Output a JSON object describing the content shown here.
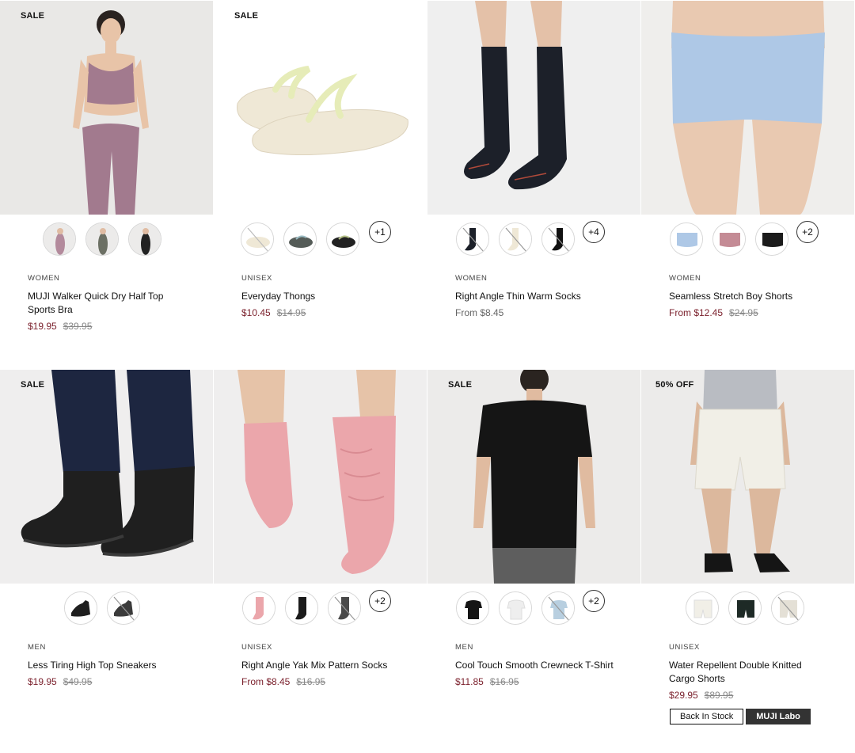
{
  "products": [
    {
      "badge": "SALE",
      "category": "WOMEN",
      "name": "MUJI Walker Quick Dry Half Top Sports Bra",
      "price": "$19.95",
      "original_price": "$39.95",
      "more_colors": ""
    },
    {
      "badge": "SALE",
      "category": "UNISEX",
      "name": "Everyday Thongs",
      "price": "$10.45",
      "original_price": "$14.95",
      "more_colors": "+1"
    },
    {
      "badge": "",
      "category": "WOMEN",
      "name": "Right Angle Thin Warm Socks",
      "price": "From $8.45",
      "original_price": "",
      "more_colors": "+4"
    },
    {
      "badge": "",
      "category": "WOMEN",
      "name": "Seamless Stretch Boy Shorts",
      "price": "From $12.45",
      "original_price": "$24.95",
      "more_colors": "+2"
    },
    {
      "badge": "SALE",
      "category": "MEN",
      "name": "Less Tiring High Top Sneakers",
      "price": "$19.95",
      "original_price": "$49.95",
      "more_colors": ""
    },
    {
      "badge": "",
      "category": "UNISEX",
      "name": "Right Angle Yak Mix Pattern Socks",
      "price": "From $8.45",
      "original_price": "$16.95",
      "more_colors": "+2"
    },
    {
      "badge": "SALE",
      "category": "MEN",
      "name": "Cool Touch Smooth Crewneck T-Shirt",
      "price": "$11.85",
      "original_price": "$16.95",
      "more_colors": "+2"
    },
    {
      "badge": "50% OFF",
      "category": "UNISEX",
      "name": "Water Repellent Double Knitted Cargo Shorts",
      "price": "$29.95",
      "original_price": "$89.95",
      "more_colors": ""
    }
  ],
  "tags": {
    "back_in_stock": "Back In Stock",
    "muji_labo": "MUJI Labo"
  },
  "colors": {
    "sale_price": "#7a1f2b",
    "original_price": "#888888",
    "accent_dark": "#333333"
  }
}
